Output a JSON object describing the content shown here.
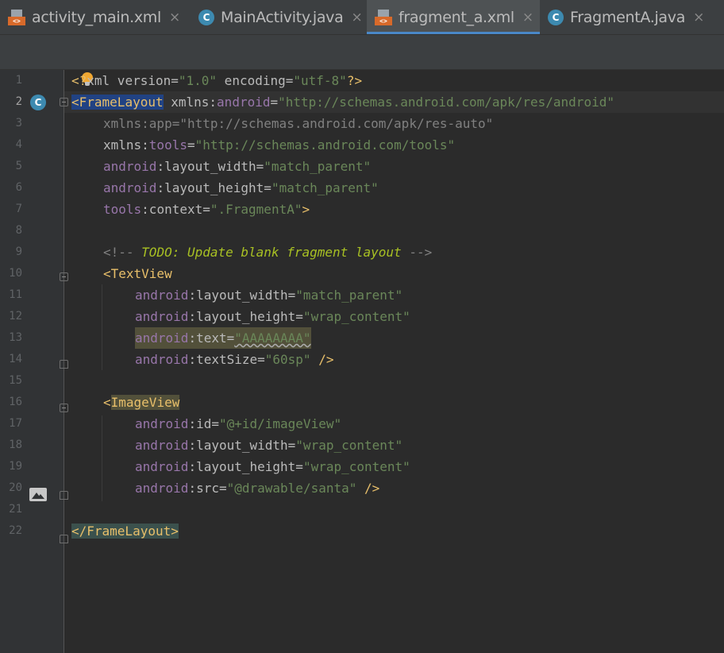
{
  "tabs": [
    {
      "label": "activity_main.xml",
      "icon": "xml-file-icon",
      "active": false
    },
    {
      "label": "MainActivity.java",
      "icon": "class-icon",
      "active": false
    },
    {
      "label": "fragment_a.xml",
      "icon": "xml-file-icon",
      "active": true
    },
    {
      "label": "FragmentA.java",
      "icon": "class-icon",
      "active": false
    }
  ],
  "tab_close_glyph": "×",
  "class_glyph": "C",
  "editor": {
    "current_line": 2,
    "line_numbers": [
      "1",
      "2",
      "3",
      "4",
      "5",
      "6",
      "7",
      "8",
      "9",
      "10",
      "11",
      "12",
      "13",
      "14",
      "15",
      "16",
      "17",
      "18",
      "19",
      "20",
      "21",
      "22"
    ],
    "lines": {
      "l1": {
        "a": "<?",
        "b": "xml",
        "c": " version=",
        "d": "\"1.0\"",
        "e": " encoding=",
        "f": "\"utf-8\"",
        "g": "?>"
      },
      "l2": {
        "a": "<",
        "b": "FrameLayout",
        "c": " xmlns:",
        "d": "android",
        "e": "=",
        "f": "\"http://schemas.android.com/apk/res/android\""
      },
      "l3": {
        "a": "xmlns:app=",
        "b": "\"http://schemas.android.com/apk/res-auto\""
      },
      "l4": {
        "a": "xmlns:",
        "b": "tools",
        "c": "=",
        "d": "\"http://schemas.android.com/tools\""
      },
      "l5": {
        "a": "android",
        "b": ":layout_width=",
        "c": "\"match_parent\""
      },
      "l6": {
        "a": "android",
        "b": ":layout_height=",
        "c": "\"match_parent\""
      },
      "l7": {
        "a": "tools",
        "b": ":context=",
        "c": "\".FragmentA\"",
        "d": ">"
      },
      "l9": {
        "a": "<!-- ",
        "b": "TODO: Update blank fragment layout",
        "c": " -->"
      },
      "l10": {
        "a": "<TextView"
      },
      "l11": {
        "a": "android",
        "b": ":layout_width=",
        "c": "\"match_parent\""
      },
      "l12": {
        "a": "android",
        "b": ":layout_height=",
        "c": "\"wrap_content\""
      },
      "l13": {
        "a": "android",
        "b": ":text=",
        "c": "\"AAAAAAAA\""
      },
      "l14": {
        "a": "android",
        "b": ":textSize=",
        "c": "\"60sp\"",
        "d": " />"
      },
      "l16": {
        "a": "<",
        "b": "ImageView"
      },
      "l17": {
        "a": "android",
        "b": ":id=",
        "c": "\"@+id/imageView\""
      },
      "l18": {
        "a": "android",
        "b": ":layout_width=",
        "c": "\"wrap_content\""
      },
      "l19": {
        "a": "android",
        "b": ":layout_height=",
        "c": "\"wrap_content\""
      },
      "l20": {
        "a": "android",
        "b": ":src=",
        "c": "\"@drawable/santa\"",
        "d": " />"
      },
      "l22": {
        "a": "</FrameLayout>"
      }
    }
  },
  "colors": {
    "background": "#2b2b2b",
    "gutter": "#313335",
    "tag": "#e8bf6a",
    "namespace": "#9876aa",
    "value": "#6a8759",
    "comment": "#808080",
    "todo": "#a8c023",
    "accent": "#4a88c7"
  }
}
